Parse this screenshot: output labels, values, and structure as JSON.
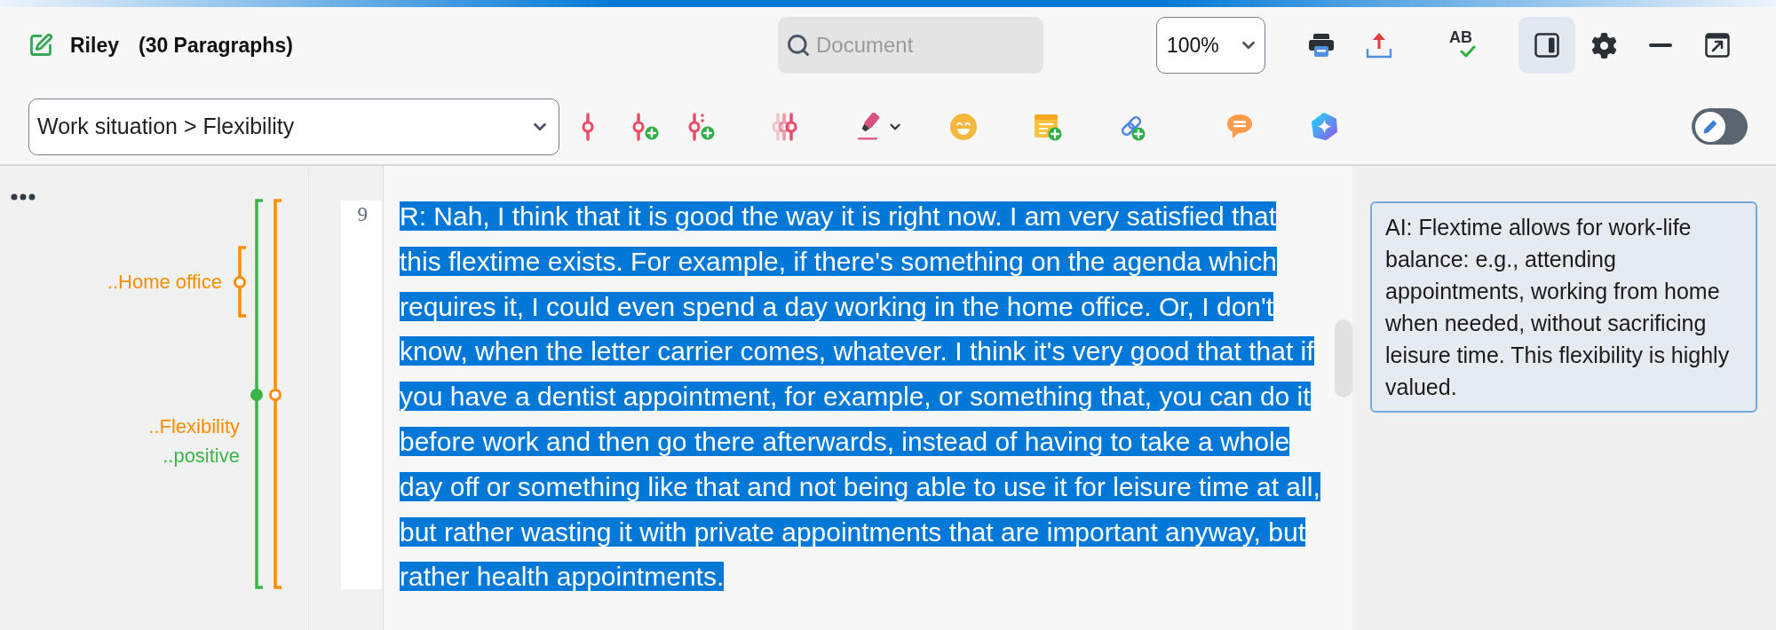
{
  "header": {
    "title": "Riley",
    "count": "(30 Paragraphs)",
    "search": {
      "placeholder": "Document"
    },
    "zoom": {
      "value": "100%"
    },
    "spellcheck": {
      "label": "AB"
    },
    "panel_toggle": {
      "selected": true
    }
  },
  "code_bar": {
    "code_select": {
      "value": "Work situation > Flexibility"
    },
    "mode_switch": {
      "on": false
    }
  },
  "margin": {
    "stripes": [
      {
        "label": "..Home office",
        "color": "#ff8c00",
        "filled": false
      },
      {
        "label": "..Flexibility",
        "color": "#ff8c00",
        "filled": false
      },
      {
        "label": "..positive",
        "color": "#3bb54a",
        "filled": true
      }
    ]
  },
  "document": {
    "paragraph": {
      "number": "9",
      "text": "R: Nah, I think that it is good the way it is right now. I am very satisfied that this flextime exists. For example, if there's something on the agenda which requires it, I could even spend a day working in the home office. Or, I don't know, when the letter carrier comes, whatever. I think it's very good that that if you have a dentist appointment, for example, or something that, you can do it before work and then go there afterwards, instead of having to take a whole day off or something like that and not being able to use it for leisure time at all, but rather wasting it with private appointments that are important anyway, but rather health appointments.",
      "selected": true
    }
  },
  "memo": {
    "text": "AI: Flextime allows for work-life balance: e.g., attending appointments, working from home when needed, without sacrificing leisure time. This flexibility is highly valued."
  }
}
